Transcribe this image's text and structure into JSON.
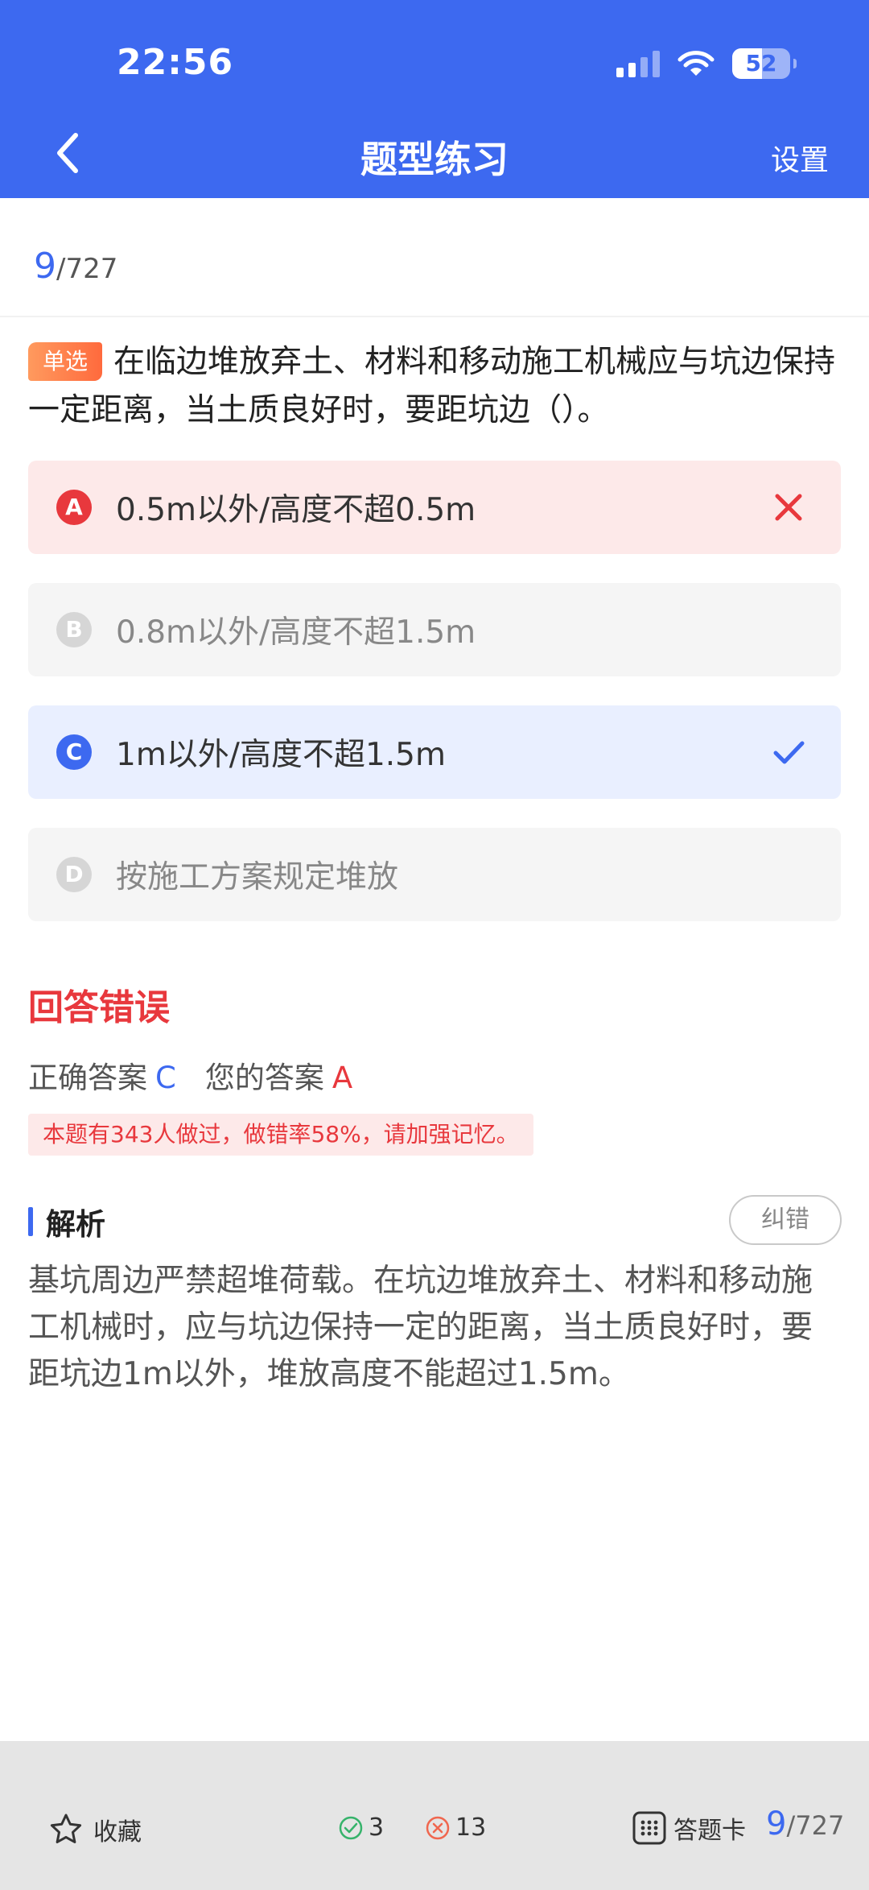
{
  "status_bar": {
    "time": "22:56",
    "battery": "52"
  },
  "header": {
    "title": "题型练习",
    "settings_label": "设置"
  },
  "progress": {
    "current": "9",
    "total": "/727"
  },
  "question": {
    "type_tag": "单选",
    "text": "在临边堆放弃土、材料和移动施工机械应与坑边保持一定距离，当土质良好时，要距坑边（）。"
  },
  "options": [
    {
      "letter": "A",
      "text": "0.5m以外/高度不超0.5m",
      "state": "wrong"
    },
    {
      "letter": "B",
      "text": "0.8m以外/高度不超1.5m",
      "state": "normal"
    },
    {
      "letter": "C",
      "text": "1m以外/高度不超1.5m",
      "state": "correct"
    },
    {
      "letter": "D",
      "text": "按施工方案规定堆放",
      "state": "normal"
    }
  ],
  "result": {
    "title": "回答错误",
    "correct_label": "正确答案",
    "correct_value": "C",
    "your_label": "您的答案",
    "your_value": "A",
    "stat_text": "本题有343人做过，做错率58%，请加强记忆。"
  },
  "analysis": {
    "heading": "解析",
    "report_label": "纠错",
    "text": "基坑周边严禁超堆荷载。在坑边堆放弃土、材料和移动施工机械时，应与坑边保持一定的距离，当土质良好时，要距坑边1m以外，堆放高度不能超过1.5m。"
  },
  "bottom_bar": {
    "favorite_label": "收藏",
    "correct_count": "3",
    "wrong_count": "13",
    "answer_card_label": "答题卡",
    "current": "9",
    "total": "/727"
  },
  "colors": {
    "primary": "#3d69f0",
    "error": "#e8383d",
    "tag": "#ff7a45"
  }
}
